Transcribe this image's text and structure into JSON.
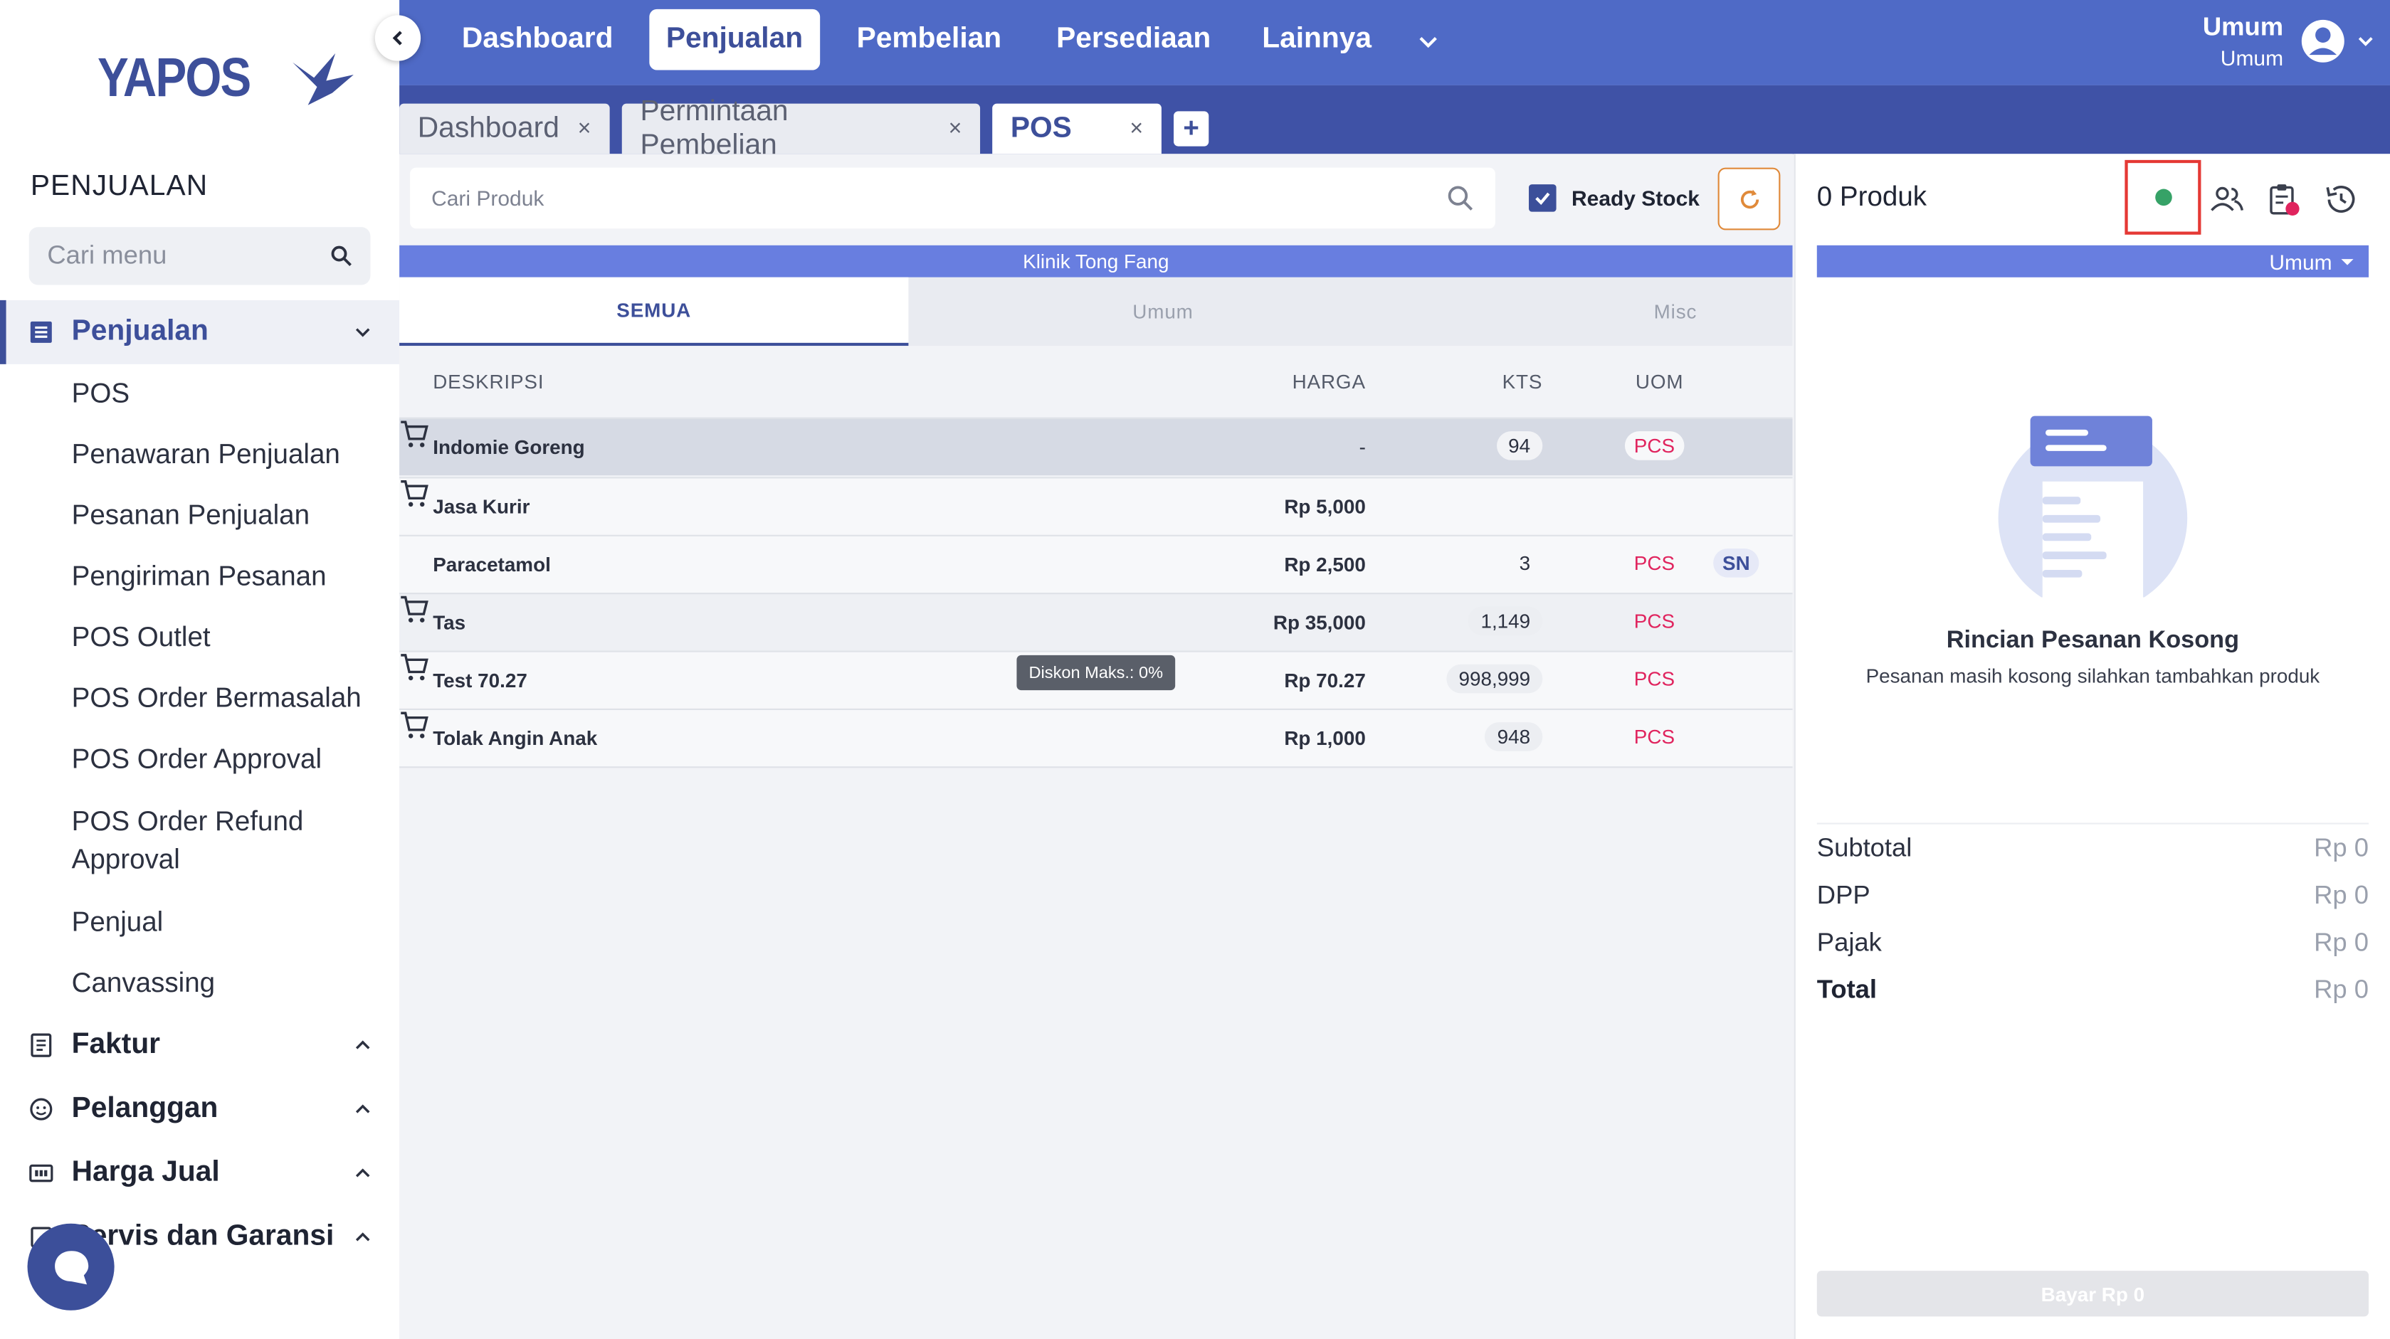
{
  "brand": {
    "name": "YAPOS"
  },
  "sidebar": {
    "section_title": "PENJUALAN",
    "search_placeholder": "Cari menu",
    "groups": [
      {
        "label": "Penjualan",
        "active": true
      },
      {
        "label": "Faktur"
      },
      {
        "label": "Pelanggan"
      },
      {
        "label": "Harga Jual"
      },
      {
        "label": "Servis dan Garansi"
      }
    ],
    "sub_items": [
      "POS",
      "Penawaran Penjualan",
      "Pesanan Penjualan",
      "Pengiriman Pesanan",
      "POS Outlet",
      "POS Order Bermasalah",
      "POS Order Approval",
      "POS Order Refund Approval",
      "Penjual",
      "Canvassing"
    ]
  },
  "topnav": {
    "items": [
      "Dashboard",
      "Penjualan",
      "Pembelian",
      "Persediaan",
      "Lainnya"
    ],
    "active": "Penjualan",
    "user": {
      "name": "Umum",
      "role": "Umum"
    }
  },
  "tabs": [
    {
      "label": "Dashboard",
      "close": "×"
    },
    {
      "label": "Permintaan Pembelian",
      "close": "×"
    },
    {
      "label": "POS",
      "close": "×",
      "active": true
    }
  ],
  "add_tab": "+",
  "pos": {
    "search_placeholder": "Cari Produk",
    "ready_stock_label": "Ready Stock",
    "ready_stock_checked": true,
    "location": "Klinik Tong Fang",
    "categories": [
      "SEMUA",
      "Umum",
      "Misc"
    ],
    "columns": {
      "desc": "DESKRIPSI",
      "price": "HARGA",
      "qty": "KTS",
      "uom": "UOM"
    },
    "rows": [
      {
        "desc": "Indomie Goreng",
        "price": "-",
        "qty": "94",
        "uom": "PCS",
        "action": "cart"
      },
      {
        "desc": "Jasa Kurir",
        "price": "Rp 5,000",
        "qty": "",
        "uom": "",
        "action": "cart"
      },
      {
        "desc": "Paracetamol",
        "price": "Rp 2,500",
        "qty": "3",
        "uom": "PCS",
        "action": "SN"
      },
      {
        "desc": "Tas",
        "price": "Rp 35,000",
        "qty": "1,149",
        "uom": "PCS",
        "action": "cart"
      },
      {
        "desc": "Test 70.27",
        "price": "Rp 70.27",
        "qty": "998,999",
        "uom": "PCS",
        "action": "cart"
      },
      {
        "desc": "Tolak Angin Anak",
        "price": "Rp 1,000",
        "qty": "948",
        "uom": "PCS",
        "action": "cart"
      }
    ],
    "tooltip": "Diskon Maks.: 0%"
  },
  "order": {
    "title": "0 Produk",
    "customer": "Umum",
    "empty_title": "Rincian Pesanan Kosong",
    "empty_sub": "Pesanan masih kosong silahkan tambahkan produk",
    "summary": [
      {
        "label": "Subtotal",
        "value": "Rp 0"
      },
      {
        "label": "DPP",
        "value": "Rp 0"
      },
      {
        "label": "Pajak",
        "value": "Rp 0"
      },
      {
        "label": "Total",
        "value": "Rp 0"
      }
    ],
    "pay_label": "Bayar Rp 0"
  },
  "colors": {
    "primary": "#3d4f9a",
    "nav": "#4f6ac6",
    "accent_bar": "#687ee0",
    "status_online": "#36a267",
    "uom": "#e0245e"
  }
}
